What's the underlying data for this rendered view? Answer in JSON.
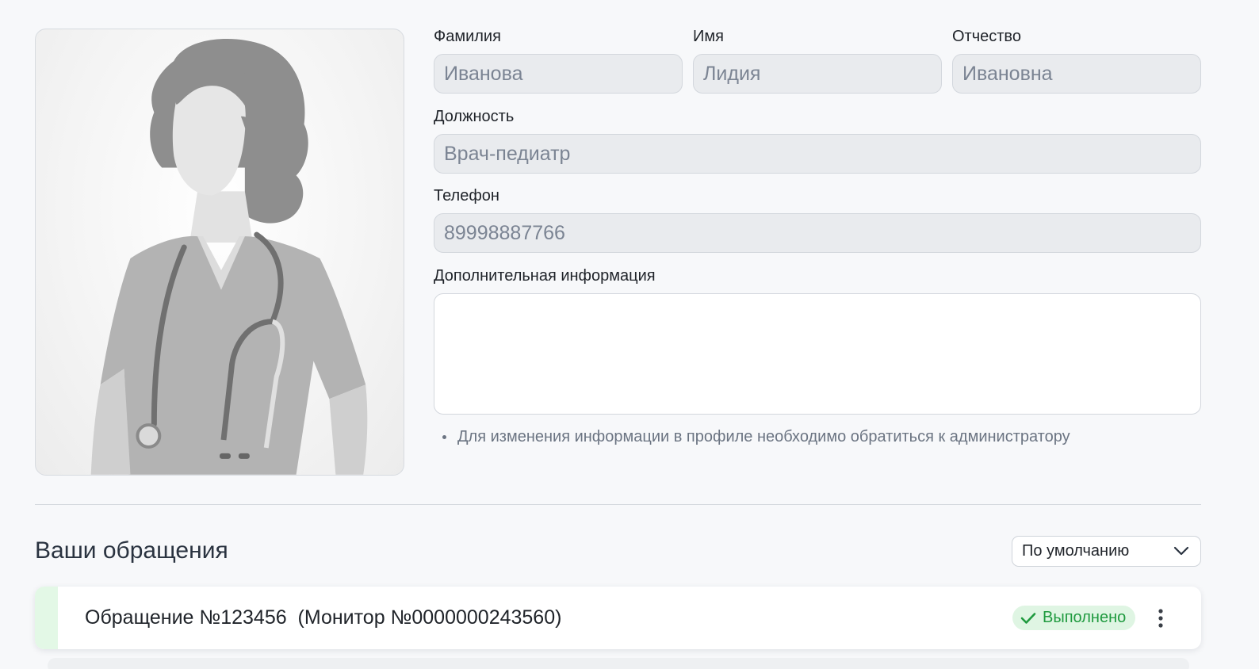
{
  "profile": {
    "photo_alt": "",
    "fields": {
      "last_name": {
        "label": "Фамилия",
        "value": "Иванова"
      },
      "first_name": {
        "label": "Имя",
        "value": "Лидия"
      },
      "patronymic": {
        "label": "Отчество",
        "value": "Ивановна"
      },
      "position": {
        "label": "Должность",
        "value": "Врач-педиатр"
      },
      "phone": {
        "label": "Телефон",
        "value": "89998887766"
      },
      "additional_info": {
        "label": "Дополнительная информация",
        "value": ""
      }
    },
    "note": "Для изменения информации в профиле необходимо обратиться к администратору"
  },
  "requests": {
    "title": "Ваши обращения",
    "sort": {
      "selected": "По умолчанию"
    },
    "items": [
      {
        "title": "Обращение №123456  (Монитор №0000000243560)",
        "status": "Выполнено",
        "status_color": "#1f9a3f",
        "status_bg": "#dff5e3",
        "accent_color": "#e3f8e6"
      }
    ]
  },
  "icons": {
    "avatar": "doctor-silhouette",
    "sort": "chevron-down-icon",
    "status": "check-icon",
    "more": "kebab-menu-icon"
  }
}
